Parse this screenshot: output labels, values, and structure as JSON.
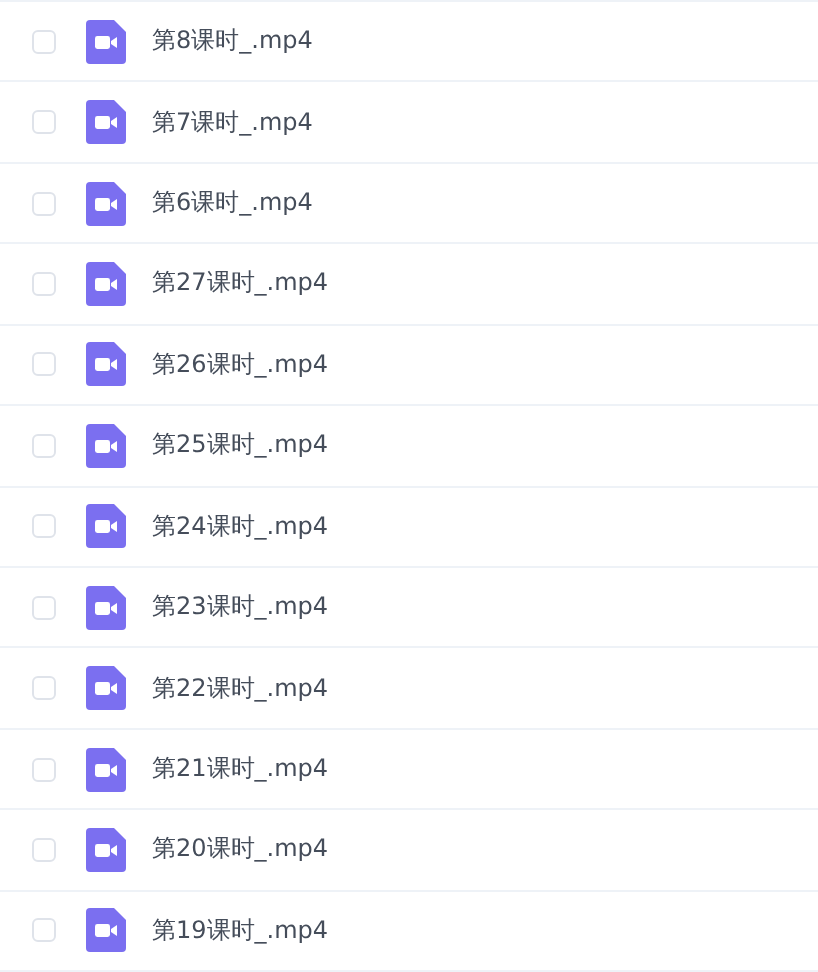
{
  "files": [
    {
      "name": "第8课时_.mp4",
      "checked": false
    },
    {
      "name": "第7课时_.mp4",
      "checked": false
    },
    {
      "name": "第6课时_.mp4",
      "checked": false
    },
    {
      "name": "第27课时_.mp4",
      "checked": false
    },
    {
      "name": "第26课时_.mp4",
      "checked": false
    },
    {
      "name": "第25课时_.mp4",
      "checked": false
    },
    {
      "name": "第24课时_.mp4",
      "checked": false
    },
    {
      "name": "第23课时_.mp4",
      "checked": false
    },
    {
      "name": "第22课时_.mp4",
      "checked": false
    },
    {
      "name": "第21课时_.mp4",
      "checked": false
    },
    {
      "name": "第20课时_.mp4",
      "checked": false
    },
    {
      "name": "第19课时_.mp4",
      "checked": false
    }
  ]
}
